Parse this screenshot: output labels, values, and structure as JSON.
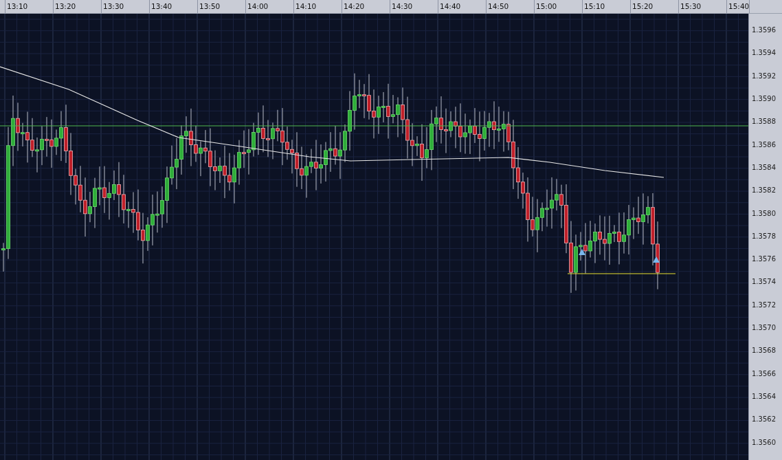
{
  "time_axis": {
    "labels": [
      "13:10",
      "13:20",
      "13:30",
      "13:40",
      "13:50",
      "14:00",
      "14:10",
      "14:20",
      "14:30",
      "14:40",
      "14:50",
      "15:00",
      "15:10",
      "15:20",
      "15:30",
      "15:40"
    ]
  },
  "price_axis": {
    "labels": [
      "1.3596",
      "1.3594",
      "1.3592",
      "1.3590",
      "1.3588",
      "1.3586",
      "1.3584",
      "1.3582",
      "1.3580",
      "1.3578",
      "1.3576",
      "1.3574",
      "1.3572",
      "1.3570",
      "1.3568",
      "1.3566",
      "1.3564",
      "1.3562",
      "1.3560"
    ]
  }
}
